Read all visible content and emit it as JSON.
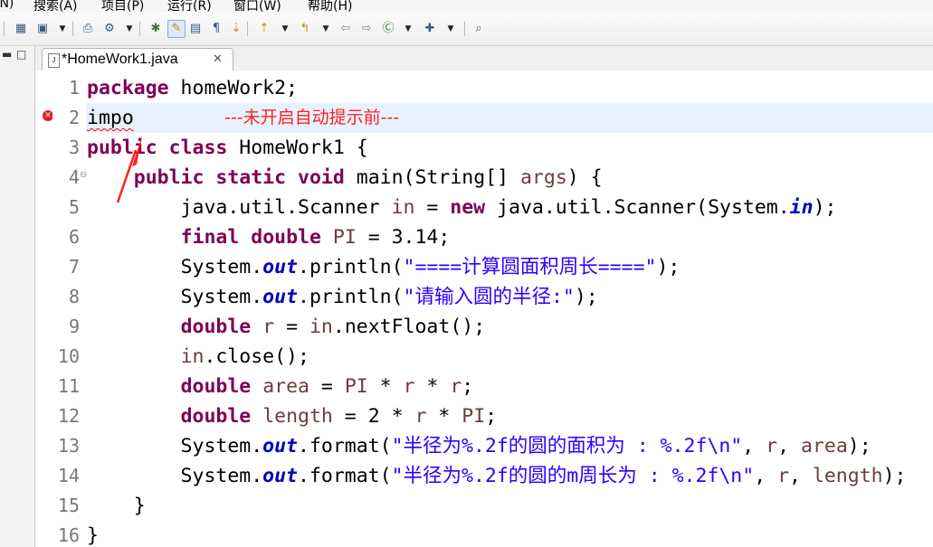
{
  "menu": {
    "items": [
      {
        "label": "(N)"
      },
      {
        "label": "搜索(A)"
      },
      {
        "label": "项目(P)"
      },
      {
        "label": "运行(R)"
      },
      {
        "label": "窗口(W)"
      },
      {
        "label": "帮助(H)"
      }
    ]
  },
  "editor": {
    "tab": {
      "title": "*HomeWork1.java",
      "close_glyph": "✕"
    },
    "annotation": "---未开启自动提示前---",
    "lines": [
      {
        "n": "1",
        "segs": [
          {
            "t": "package",
            "c": "kw"
          },
          {
            "t": " homeWork2;"
          }
        ]
      },
      {
        "n": "2",
        "segs": [
          {
            "t": "impo",
            "c": "err"
          }
        ]
      },
      {
        "n": "3",
        "segs": [
          {
            "t": "public",
            "c": "kw"
          },
          {
            "t": " "
          },
          {
            "t": "class",
            "c": "kw"
          },
          {
            "t": " HomeWork1 {"
          }
        ]
      },
      {
        "n": "4",
        "segs": [
          {
            "t": "    "
          },
          {
            "t": "public",
            "c": "kw"
          },
          {
            "t": " "
          },
          {
            "t": "static",
            "c": "kw"
          },
          {
            "t": " "
          },
          {
            "t": "void",
            "c": "kw"
          },
          {
            "t": " main(String[] "
          },
          {
            "t": "args",
            "c": "var"
          },
          {
            "t": ") {"
          }
        ]
      },
      {
        "n": "5",
        "segs": [
          {
            "t": "        java.util.Scanner "
          },
          {
            "t": "in",
            "c": "var"
          },
          {
            "t": " = "
          },
          {
            "t": "new",
            "c": "kw"
          },
          {
            "t": " java.util.Scanner(System."
          },
          {
            "t": "in",
            "c": "fld"
          },
          {
            "t": ");"
          }
        ]
      },
      {
        "n": "6",
        "segs": [
          {
            "t": "        "
          },
          {
            "t": "final",
            "c": "kw"
          },
          {
            "t": " "
          },
          {
            "t": "double",
            "c": "kw"
          },
          {
            "t": " "
          },
          {
            "t": "PI",
            "c": "var"
          },
          {
            "t": " = 3.14;"
          }
        ]
      },
      {
        "n": "7",
        "segs": [
          {
            "t": "        System."
          },
          {
            "t": "out",
            "c": "fld"
          },
          {
            "t": ".println("
          },
          {
            "t": "\"====计算圆面积周长====\"",
            "c": "str"
          },
          {
            "t": ");"
          }
        ]
      },
      {
        "n": "8",
        "segs": [
          {
            "t": "        System."
          },
          {
            "t": "out",
            "c": "fld"
          },
          {
            "t": ".println("
          },
          {
            "t": "\"请输入圆的半径:\"",
            "c": "str"
          },
          {
            "t": ");"
          }
        ]
      },
      {
        "n": "9",
        "segs": [
          {
            "t": "        "
          },
          {
            "t": "double",
            "c": "kw"
          },
          {
            "t": " "
          },
          {
            "t": "r",
            "c": "var"
          },
          {
            "t": " = "
          },
          {
            "t": "in",
            "c": "var"
          },
          {
            "t": ".nextFloat();"
          }
        ]
      },
      {
        "n": "10",
        "segs": [
          {
            "t": "        "
          },
          {
            "t": "in",
            "c": "var"
          },
          {
            "t": ".close();"
          }
        ]
      },
      {
        "n": "11",
        "segs": [
          {
            "t": "        "
          },
          {
            "t": "double",
            "c": "kw"
          },
          {
            "t": " "
          },
          {
            "t": "area",
            "c": "var"
          },
          {
            "t": " = "
          },
          {
            "t": "PI",
            "c": "var"
          },
          {
            "t": " * "
          },
          {
            "t": "r",
            "c": "var"
          },
          {
            "t": " * "
          },
          {
            "t": "r",
            "c": "var"
          },
          {
            "t": ";"
          }
        ]
      },
      {
        "n": "12",
        "segs": [
          {
            "t": "        "
          },
          {
            "t": "double",
            "c": "kw"
          },
          {
            "t": " "
          },
          {
            "t": "length",
            "c": "var"
          },
          {
            "t": " = 2 * "
          },
          {
            "t": "r",
            "c": "var"
          },
          {
            "t": " * "
          },
          {
            "t": "PI",
            "c": "var"
          },
          {
            "t": ";"
          }
        ]
      },
      {
        "n": "13",
        "segs": [
          {
            "t": "        System."
          },
          {
            "t": "out",
            "c": "fld"
          },
          {
            "t": ".format("
          },
          {
            "t": "\"半径为%.2f的圆的面积为 : %.2f\\n\"",
            "c": "str"
          },
          {
            "t": ", "
          },
          {
            "t": "r",
            "c": "var"
          },
          {
            "t": ", "
          },
          {
            "t": "area",
            "c": "var"
          },
          {
            "t": ");"
          }
        ]
      },
      {
        "n": "14",
        "segs": [
          {
            "t": "        System."
          },
          {
            "t": "out",
            "c": "fld"
          },
          {
            "t": ".format("
          },
          {
            "t": "\"半径为%.2f的圆的m周长为 : %.2f\\n\"",
            "c": "str"
          },
          {
            "t": ", "
          },
          {
            "t": "r",
            "c": "var"
          },
          {
            "t": ", "
          },
          {
            "t": "length",
            "c": "var"
          },
          {
            "t": ");"
          }
        ]
      },
      {
        "n": "15",
        "segs": [
          {
            "t": "    }"
          }
        ]
      },
      {
        "n": "16",
        "segs": [
          {
            "t": "}"
          }
        ]
      }
    ]
  },
  "toolbar": {
    "icons": [
      "new-menu-icon",
      "save-icon",
      "print-icon",
      "build-icon",
      "debug-icon",
      "run-icon",
      "external-tools-icon",
      "new-java-project-icon",
      "new-package-icon",
      "new-class-icon",
      "open-type-icon",
      "search-icon",
      "toggle-mark-occurrences-icon",
      "toggle-word-wrap-icon",
      "show-whitespace-icon",
      "next-annotation-icon",
      "previous-annotation-icon",
      "last-edit-location-icon",
      "back-icon",
      "forward-icon",
      "pin-editor-icon"
    ]
  },
  "colors": {
    "keyword": "#7f0055",
    "string": "#2a00ff",
    "static_field": "#0000c0",
    "local_variable": "#6a3e3e",
    "annotation_text": "#ff2020",
    "current_line": "#e8f2fe",
    "line_number": "#787878"
  }
}
